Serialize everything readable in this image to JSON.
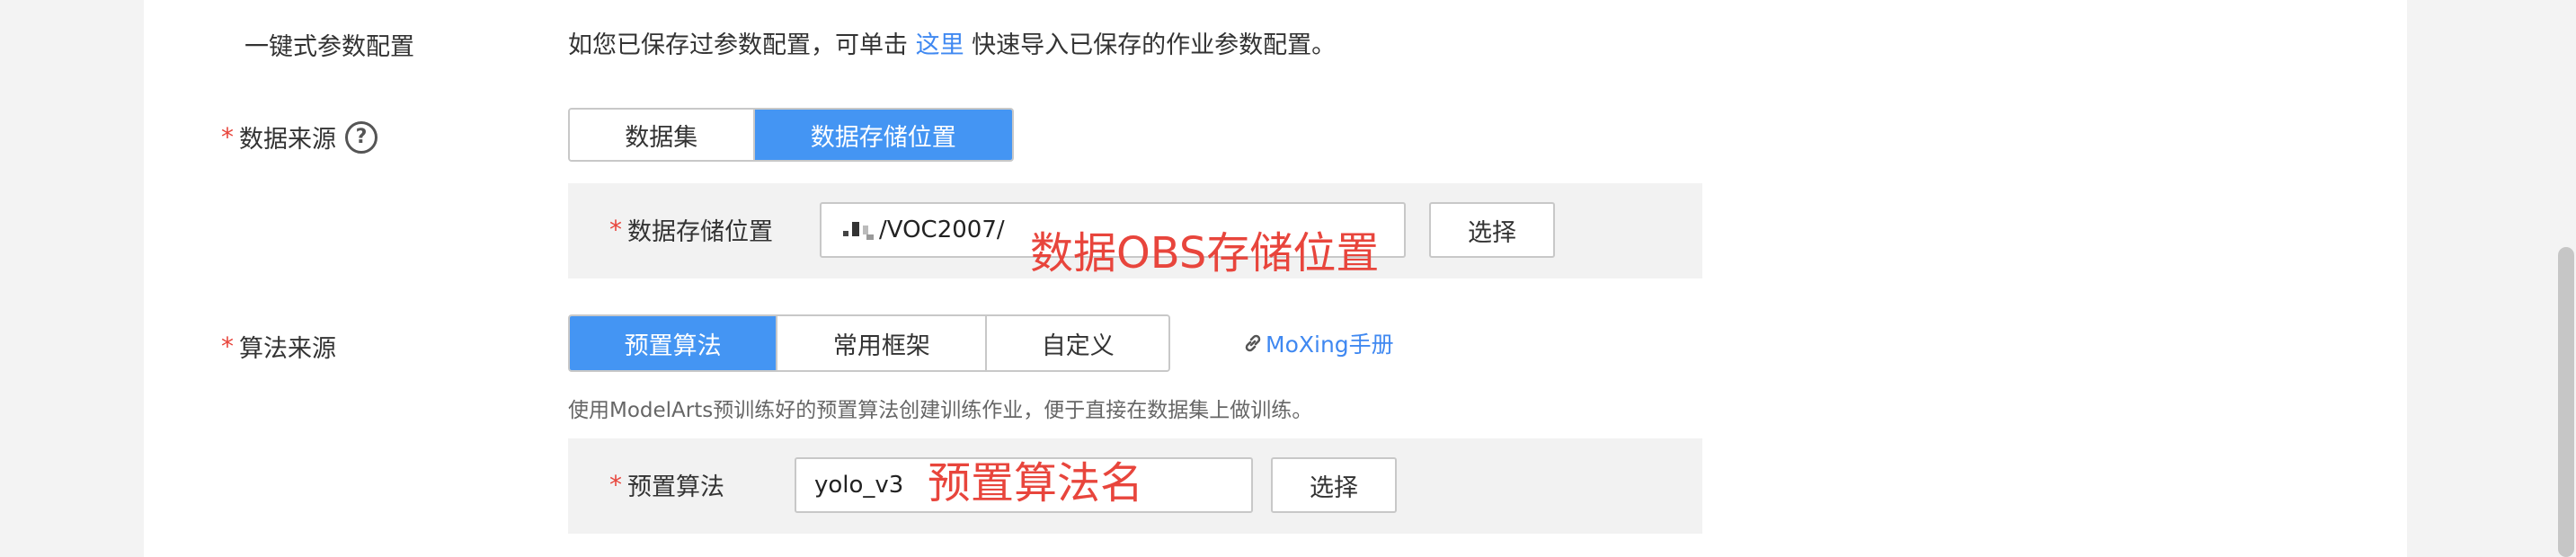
{
  "form": {
    "one_click": {
      "label": "一键式参数配置",
      "desc_before": "如您已保存过参数配置，可单击 ",
      "link_text": "这里",
      "desc_after": " 快速导入已保存的作业参数配置。"
    },
    "data_source": {
      "required_mark": "*",
      "label": "数据来源",
      "help_icon": "?",
      "options": [
        "数据集",
        "数据存储位置"
      ],
      "selected": "数据存储位置",
      "storage": {
        "required_mark": "*",
        "label": "数据存储位置",
        "value": "/VOC2007/",
        "button": "选择",
        "annotation": "数据OBS存储位置"
      }
    },
    "algorithm_source": {
      "required_mark": "*",
      "label": "算法来源",
      "options": [
        "预置算法",
        "常用框架",
        "自定义"
      ],
      "selected": "预置算法",
      "moxing_link": "MoXing手册",
      "hint": "使用ModelArts预训练好的预置算法创建训练作业，便于直接在数据集上做训练。",
      "preset": {
        "required_mark": "*",
        "label": "预置算法",
        "value": "yolo_v3",
        "button": "选择",
        "annotation": "预置算法名"
      }
    }
  },
  "colors": {
    "accent": "#4495f3",
    "link": "#3f88f1",
    "required": "#e8453c",
    "annotation": "#e8453c"
  }
}
